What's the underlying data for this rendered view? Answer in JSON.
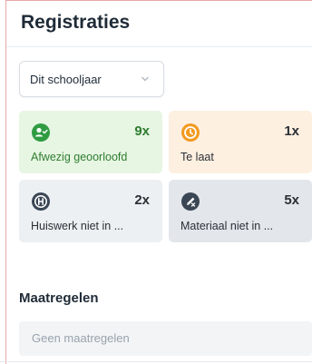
{
  "page": {
    "title": "Registraties"
  },
  "filter": {
    "selected": "Dit schooljaar"
  },
  "cards": [
    {
      "count": "9x",
      "label": "Afwezig geoorloofd",
      "icon": "person-check-icon",
      "color": "#2f9c42"
    },
    {
      "count": "1x",
      "label": "Te laat",
      "icon": "clock-icon",
      "color": "#f29a21"
    },
    {
      "count": "2x",
      "label": "Huiswerk niet in ...",
      "icon": "homework-h-icon",
      "color": "#3a4654"
    },
    {
      "count": "5x",
      "label": "Materiaal niet in ...",
      "icon": "material-pencil-icon",
      "color": "#3a4654"
    }
  ],
  "measures": {
    "title": "Maatregelen",
    "empty": "Geen maatregelen"
  }
}
